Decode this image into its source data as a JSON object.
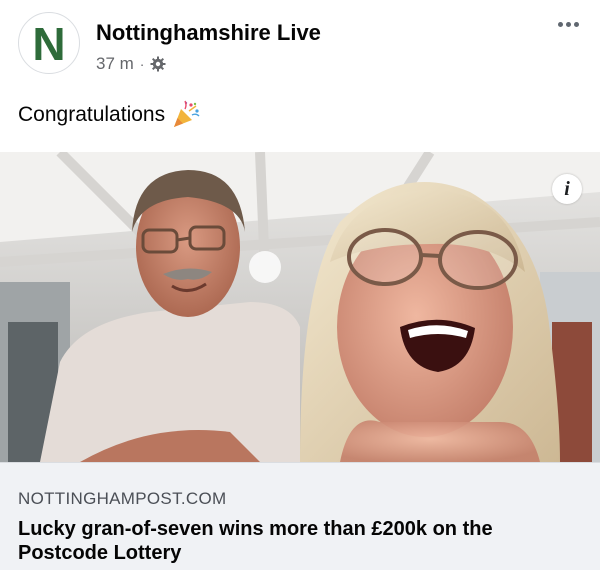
{
  "post": {
    "page_name": "Nottinghamshire Live",
    "avatar_letter": "N",
    "timestamp": "37 m",
    "separator": "·",
    "privacy_icon": "gear-icon",
    "more_icon": "more-dots-icon",
    "caption": "Congratulations",
    "caption_emoji": "party-popper-icon"
  },
  "link_preview": {
    "domain": "NOTTINGHAMPOST.COM",
    "title": "Lucky gran-of-seven wins more than £200k on the Postcode Lottery",
    "info_label": "i"
  },
  "colors": {
    "avatar_letter": "#2e6b3a",
    "secondary_text": "#65676b",
    "preview_background": "#f0f2f5"
  }
}
